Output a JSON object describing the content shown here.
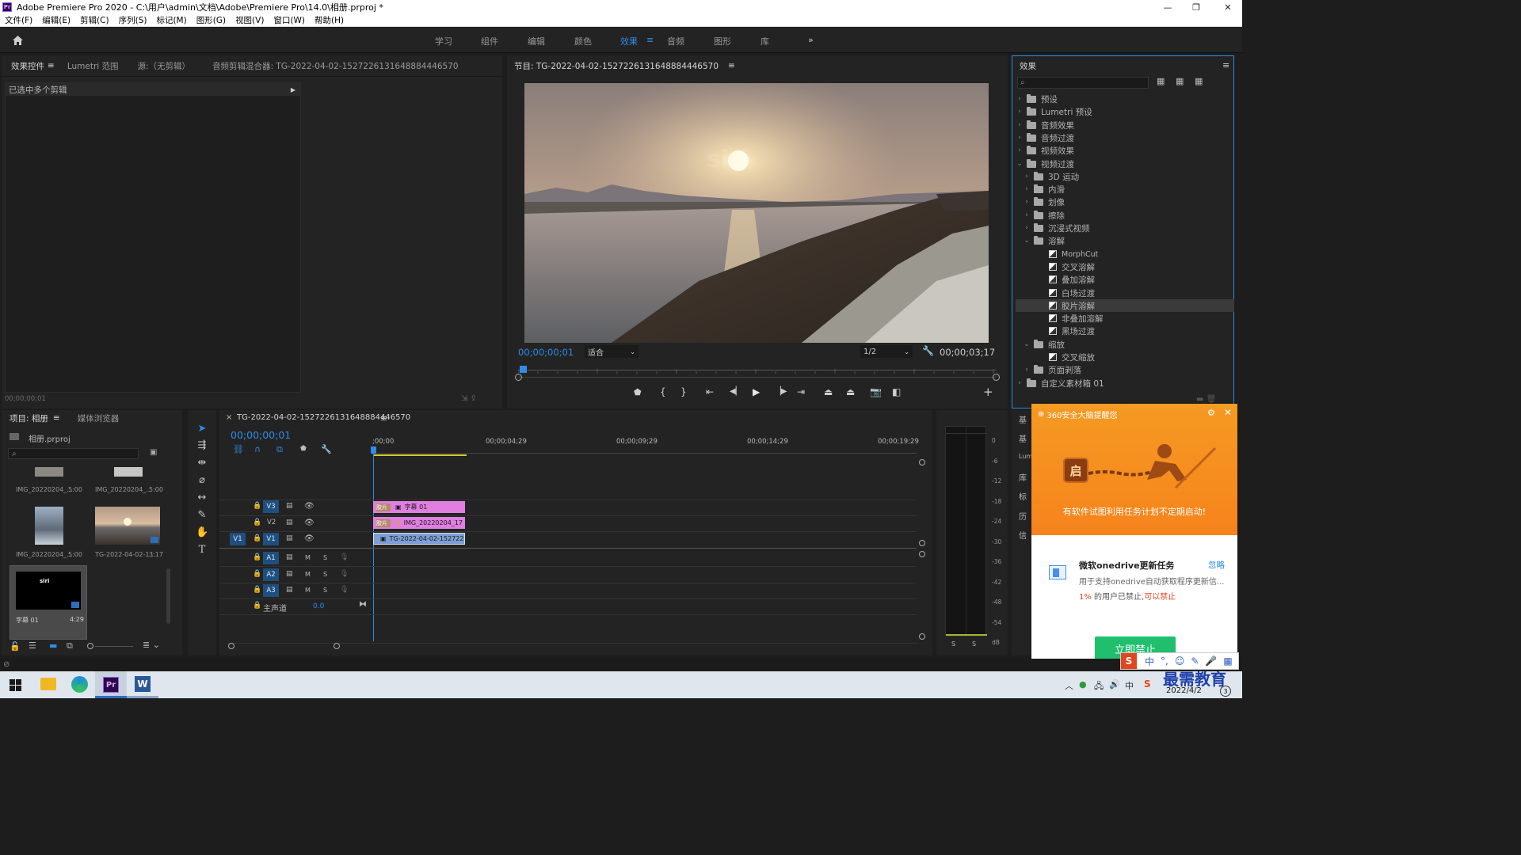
{
  "window": {
    "app_icon": "Pr",
    "title": "Adobe Premiere Pro 2020 - C:\\用户\\admin\\文档\\Adobe\\Premiere Pro\\14.0\\相册.prproj *",
    "minimize": "—",
    "restore": "❐",
    "close": "✕"
  },
  "menu": [
    "文件(F)",
    "编辑(E)",
    "剪辑(C)",
    "序列(S)",
    "标记(M)",
    "图形(G)",
    "视图(V)",
    "窗口(W)",
    "帮助(H)"
  ],
  "workspace": {
    "tabs": [
      "学习",
      "组件",
      "编辑",
      "颜色",
      "效果",
      "音频",
      "图形",
      "库"
    ],
    "active": "效果",
    "more": "»"
  },
  "effect_controls": {
    "tabs": [
      "效果控件",
      "Lumetri 范围",
      "源:（无剪辑）",
      "音频剪辑混合器: TG-2022-04-02-15272261316488844465​70"
    ],
    "header": "已选中多个剪辑",
    "timecode": "00;00;00;01"
  },
  "program": {
    "title": "节目: TG-2022-04-02-15272261316488844465​70",
    "watermark": "siri",
    "timecode_current": "00;00;00;01",
    "fit": "适合",
    "resolution": "1/2",
    "timecode_total": "00;00;03;17"
  },
  "effects": {
    "title": "效果",
    "search_placeholder": "",
    "tree": [
      {
        "label": "预设",
        "kind": "folder",
        "indent": 0,
        "open": false
      },
      {
        "label": "Lumetri 预设",
        "kind": "folder",
        "indent": 0,
        "open": false
      },
      {
        "label": "音频效果",
        "kind": "folder",
        "indent": 0,
        "open": false
      },
      {
        "label": "音频过渡",
        "kind": "folder",
        "indent": 0,
        "open": false
      },
      {
        "label": "视频效果",
        "kind": "folder",
        "indent": 0,
        "open": false
      },
      {
        "label": "视频过渡",
        "kind": "folder",
        "indent": 0,
        "open": true
      },
      {
        "label": "3D 运动",
        "kind": "folder",
        "indent": 1,
        "open": false
      },
      {
        "label": "内滑",
        "kind": "folder",
        "indent": 1,
        "open": false
      },
      {
        "label": "划像",
        "kind": "folder",
        "indent": 1,
        "open": false
      },
      {
        "label": "擦除",
        "kind": "folder",
        "indent": 1,
        "open": false
      },
      {
        "label": "沉浸式视频",
        "kind": "folder",
        "indent": 1,
        "open": false
      },
      {
        "label": "溶解",
        "kind": "folder",
        "indent": 1,
        "open": true
      },
      {
        "label": "MorphCut",
        "kind": "item",
        "indent": 2
      },
      {
        "label": "交叉溶解",
        "kind": "item",
        "indent": 2
      },
      {
        "label": "叠加溶解",
        "kind": "item",
        "indent": 2
      },
      {
        "label": "白场过渡",
        "kind": "item",
        "indent": 2
      },
      {
        "label": "胶片溶解",
        "kind": "item",
        "indent": 2,
        "selected": true
      },
      {
        "label": "非叠加溶解",
        "kind": "item",
        "indent": 2
      },
      {
        "label": "黑场过渡",
        "kind": "item",
        "indent": 2
      },
      {
        "label": "缩放",
        "kind": "folder",
        "indent": 1,
        "open": true
      },
      {
        "label": "交叉缩放",
        "kind": "item",
        "indent": 2
      },
      {
        "label": "页面剥落",
        "kind": "folder",
        "indent": 1,
        "open": false
      },
      {
        "label": "自定义素材箱 01",
        "kind": "folder",
        "indent": 0,
        "open": false
      }
    ]
  },
  "project": {
    "tabs": [
      "项目: 相册",
      "媒体浏览器"
    ],
    "file": "相册.prproj",
    "items": [
      {
        "name": "IMG_20220204_...",
        "duration": "5:00"
      },
      {
        "name": "IMG_20220204_...",
        "duration": "5:00"
      },
      {
        "name": "IMG_20220204_...",
        "duration": "5:00"
      },
      {
        "name": "TG-2022-04-02-1...",
        "duration": "3:17"
      },
      {
        "name": "字幕 01",
        "duration": "4:29"
      }
    ],
    "title_thumb_text": "siri"
  },
  "timeline": {
    "title": "TG-2022-04-02-15272261316488844465​70",
    "timecode": "00;00;00;01",
    "ruler": [
      ";00;00",
      "00;00;04;29",
      "00;00;09;29",
      "00;00;14;29",
      "00;00;19;29"
    ],
    "video_tracks": [
      "V3",
      "V2",
      "V1"
    ],
    "audio_tracks": [
      "A1",
      "A2",
      "A3"
    ],
    "source_patch": "V1",
    "master": "主声道",
    "master_value": "0.0",
    "m": "M",
    "s": "S",
    "clips": {
      "v3": "字幕 01",
      "v2": "IMG_20220204_17",
      "v1": "TG-2022-04-02-152722613",
      "transition": "胶片"
    }
  },
  "meter": {
    "scale": [
      "0",
      "-6",
      "-12",
      "-18",
      "-24",
      "-30",
      "-36",
      "-42",
      "-48",
      "-54",
      "dB"
    ],
    "solo": "S"
  },
  "side_tabs": [
    "基",
    "基",
    "Lum",
    "库",
    "标",
    "历",
    "信"
  ],
  "popup": {
    "header": "360安全大脑提醒您",
    "badge": "启",
    "alert": "有软件试图利用任务计划不定期启动!",
    "task_title": "微软onedrive更新任务",
    "ignore": "忽略",
    "desc": "用于支持onedrive自动获取程序更新信...",
    "stat_percent": "1%",
    "stat_text": " 的用户已禁止,",
    "stat_link": "可以禁止",
    "action": "立即禁止"
  },
  "taskbar": {
    "ime": "中",
    "watermark": "最需教育",
    "date": "2022/4/2",
    "notify_count": "3"
  },
  "colors": {
    "accent_blue": "#2d8ceb",
    "clip_pink": "#e07fe0",
    "clip_blue": "#7d9ed6",
    "popup_orange": "#f59a22",
    "popup_green": "#1fbf6e"
  }
}
